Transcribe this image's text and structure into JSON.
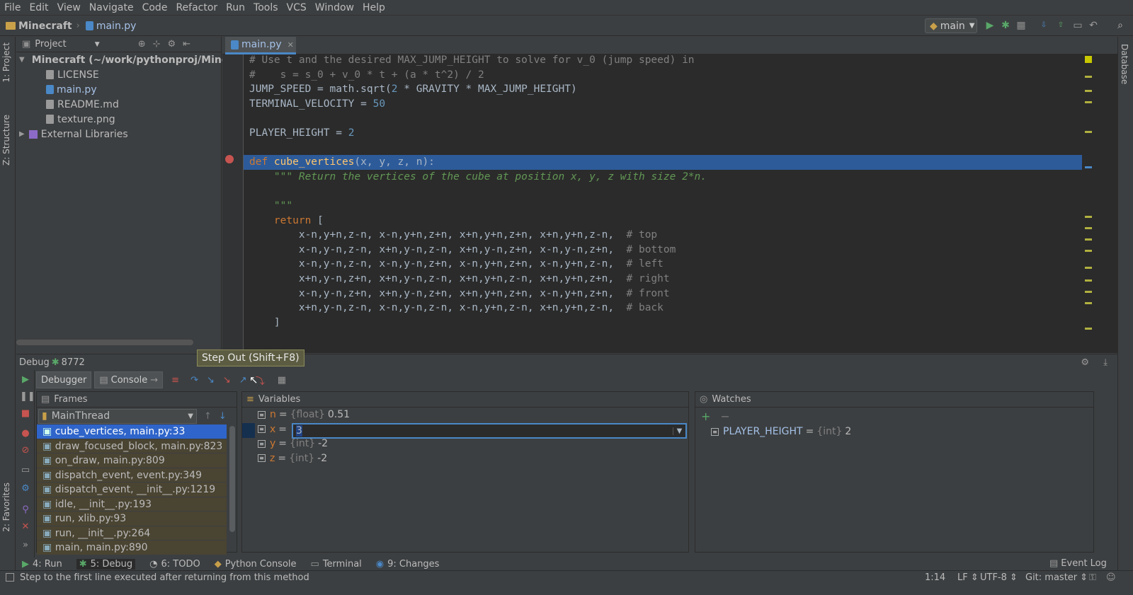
{
  "menu": [
    "File",
    "Edit",
    "View",
    "Navigate",
    "Code",
    "Refactor",
    "Run",
    "Tools",
    "VCS",
    "Window",
    "Help"
  ],
  "breadcrumb": {
    "project": "Minecraft",
    "file": "main.py"
  },
  "run_config": "main",
  "left_tabs": {
    "project": "1: Project",
    "structure": "Z: Structure",
    "favorites": "2: Favorites"
  },
  "right_tabs": {
    "database": "Database"
  },
  "project_panel": {
    "title": "Project",
    "root": "Minecraft (~/work/pythonproj/Mine",
    "files": [
      "LICENSE",
      "main.py",
      "README.md",
      "texture.png"
    ],
    "external": "External Libraries"
  },
  "editor": {
    "tab": "main.py",
    "lines": [
      {
        "type": "comment",
        "text": "# Use t and the desired MAX_JUMP_HEIGHT to solve for v_0 (jump speed) in"
      },
      {
        "type": "comment",
        "text": "#    s = s_0 + v_0 * t + (a * t^2) / 2"
      },
      {
        "type": "code",
        "a": "JUMP_SPEED = math.sqrt(",
        "b": "2",
        "c": " * GRAVITY * MAX_JUMP_HEIGHT)"
      },
      {
        "type": "code",
        "a": "TERMINAL_VELOCITY = ",
        "b": "50",
        "c": ""
      },
      {
        "type": "blank",
        "text": ""
      },
      {
        "type": "code",
        "a": "PLAYER_HEIGHT = ",
        "b": "2",
        "c": ""
      },
      {
        "type": "blank",
        "text": ""
      },
      {
        "type": "def",
        "kw": "def ",
        "fn": "cube_vertices",
        "params": "(x, y, z, n):"
      },
      {
        "type": "doc",
        "text": "    \"\"\" Return the vertices of the cube at position x, y, z with size 2*n."
      },
      {
        "type": "blank",
        "text": ""
      },
      {
        "type": "doc",
        "text": "    \"\"\""
      },
      {
        "type": "return",
        "kw": "    return ",
        "text": "["
      },
      {
        "type": "row",
        "text": "        x-n,y+n,z-n, x-n,y+n,z+n, x+n,y+n,z+n, x+n,y+n,z-n,  ",
        "cmt": "# top"
      },
      {
        "type": "row",
        "text": "        x-n,y-n,z-n, x+n,y-n,z-n, x+n,y-n,z+n, x-n,y-n,z+n,  ",
        "cmt": "# bottom"
      },
      {
        "type": "row",
        "text": "        x-n,y-n,z-n, x-n,y-n,z+n, x-n,y+n,z+n, x-n,y+n,z-n,  ",
        "cmt": "# left"
      },
      {
        "type": "row",
        "text": "        x+n,y-n,z+n, x+n,y-n,z-n, x+n,y+n,z-n, x+n,y+n,z+n,  ",
        "cmt": "# right"
      },
      {
        "type": "row",
        "text": "        x-n,y-n,z+n, x+n,y-n,z+n, x+n,y+n,z+n, x-n,y+n,z+n,  ",
        "cmt": "# front"
      },
      {
        "type": "row",
        "text": "        x+n,y-n,z-n, x-n,y-n,z-n, x-n,y+n,z-n, x+n,y+n,z-n,  ",
        "cmt": "# back"
      },
      {
        "type": "plain",
        "text": "    ]"
      }
    ]
  },
  "debug": {
    "title": "Debug",
    "session": "8772",
    "tabs": {
      "debugger": "Debugger",
      "console": "Console"
    },
    "tooltip": "Step Out (Shift+F8)",
    "frames_title": "Frames",
    "thread": "MainThread",
    "frames": [
      "cube_vertices, main.py:33",
      "draw_focused_block, main.py:823",
      "on_draw, main.py:809",
      "dispatch_event, event.py:349",
      "dispatch_event, __init__.py:1219",
      "idle, __init__.py:193",
      "run, xlib.py:93",
      "run, __init__.py:264",
      "main, main.py:890"
    ],
    "variables_title": "Variables",
    "variables": [
      {
        "name": "n",
        "type": "{float}",
        "value": "0.51"
      },
      {
        "name": "x",
        "type": "",
        "value": ""
      },
      {
        "name": "y",
        "type": "{int}",
        "value": "-2"
      },
      {
        "name": "z",
        "type": "{int}",
        "value": "-2"
      }
    ],
    "edit_value": "3",
    "watches_title": "Watches",
    "watches": [
      {
        "name": "PLAYER_HEIGHT",
        "type": "{int}",
        "value": "2"
      }
    ]
  },
  "bottom_tabs": [
    "4: Run",
    "5: Debug",
    "6: TODO",
    "Python Console",
    "Terminal",
    "9: Changes"
  ],
  "event_log": "Event Log",
  "status": {
    "message": "Step to the first line executed after returning from this method",
    "position": "1:14",
    "line_sep": "LF",
    "encoding": "UTF-8",
    "vcs": "Git: master"
  }
}
